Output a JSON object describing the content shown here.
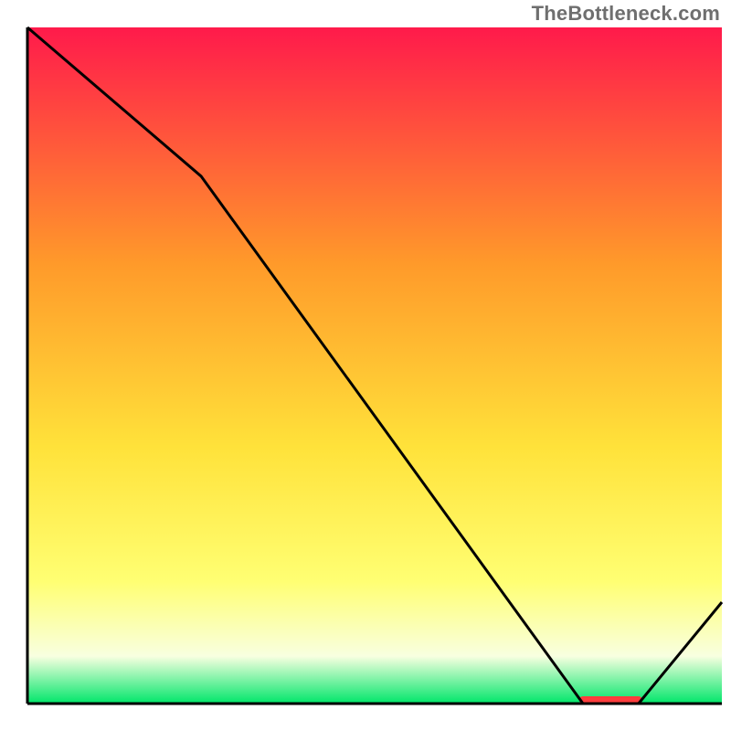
{
  "watermark": "TheBottleneck.com",
  "colors": {
    "top": "#ff1a4b",
    "mid_upper": "#ff9a2a",
    "mid": "#ffe23a",
    "mid_lower": "#ffff73",
    "near_bottom": "#f8ffe0",
    "bottom": "#00e66a",
    "axis": "#000000",
    "line": "#000000",
    "marker": "#ff3d3d"
  },
  "chart_data": {
    "type": "line",
    "title": "",
    "xlabel": "",
    "ylabel": "",
    "xlim": [
      0,
      100
    ],
    "ylim": [
      0,
      100
    ],
    "x": [
      0,
      25,
      80,
      88,
      100
    ],
    "values": [
      100,
      78,
      0,
      0,
      15
    ],
    "marker_segment": {
      "x0": 80,
      "x1": 88,
      "y": 0
    },
    "notes": "Line chart over a vertical red-to-green gradient; minimum sits on x-axis between ~80 and ~88, then rises toward the right edge."
  }
}
